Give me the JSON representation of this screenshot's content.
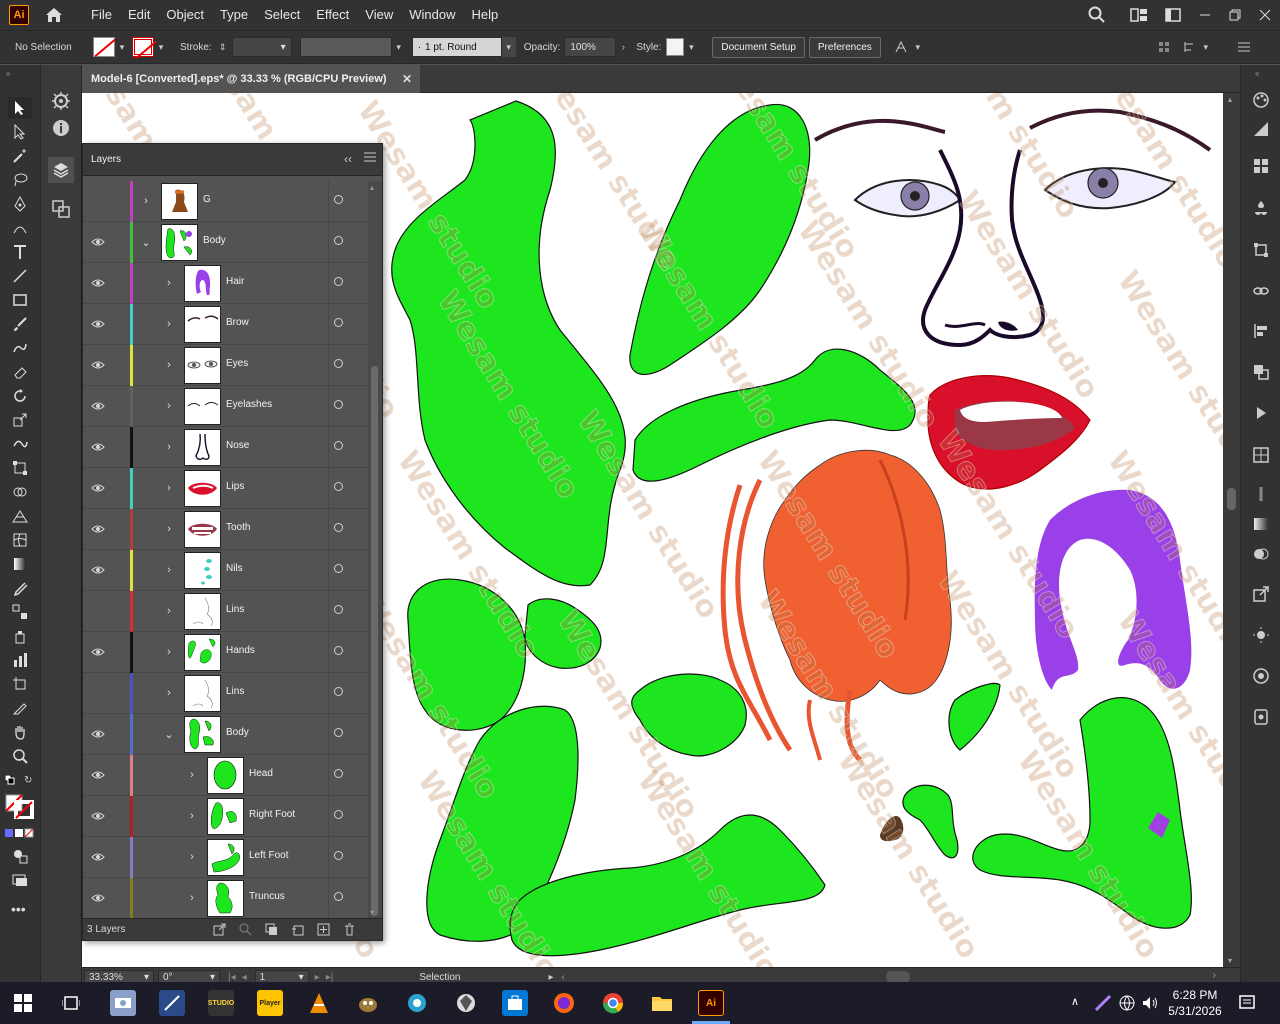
{
  "app": {
    "logo": "Ai",
    "menu": [
      "File",
      "Edit",
      "Object",
      "Type",
      "Select",
      "Effect",
      "View",
      "Window",
      "Help"
    ]
  },
  "control_bar": {
    "selection_state": "No Selection",
    "stroke_label": "Stroke:",
    "brush": "1 pt. Round",
    "opacity_label": "Opacity:",
    "opacity_value": "100%",
    "style_label": "Style:",
    "document_setup": "Document Setup",
    "preferences": "Preferences"
  },
  "document": {
    "tab_title": "Model-6 [Converted].eps* @ 33.33 % (RGB/CPU Preview)"
  },
  "layers_panel": {
    "title": "Layers",
    "footer_count": "3 Layers",
    "rows": [
      {
        "name": "G",
        "visible": false,
        "color": "#c040c0",
        "depth": 0,
        "expanded": false
      },
      {
        "name": "Body",
        "visible": true,
        "color": "#40c040",
        "depth": 0,
        "expanded": true
      },
      {
        "name": "Hair",
        "visible": true,
        "color": "#c040c0",
        "depth": 1,
        "expanded": false
      },
      {
        "name": "Brow",
        "visible": true,
        "color": "#40d0d0",
        "depth": 1,
        "expanded": false
      },
      {
        "name": "Eyes",
        "visible": true,
        "color": "#e0e040",
        "depth": 1,
        "expanded": false
      },
      {
        "name": "Eyelashes",
        "visible": true,
        "color": "#606060",
        "depth": 1,
        "expanded": false
      },
      {
        "name": "Nose",
        "visible": true,
        "color": "#101010",
        "depth": 1,
        "expanded": false
      },
      {
        "name": "Lips",
        "visible": true,
        "color": "#40d0c0",
        "depth": 1,
        "expanded": false
      },
      {
        "name": "Tooth",
        "visible": true,
        "color": "#b04040",
        "depth": 1,
        "expanded": false
      },
      {
        "name": "Nils",
        "visible": true,
        "color": "#e0e040",
        "depth": 1,
        "expanded": false
      },
      {
        "name": "Lins",
        "visible": false,
        "color": "#d03030",
        "depth": 1,
        "expanded": false
      },
      {
        "name": "Hands",
        "visible": true,
        "color": "#101010",
        "depth": 1,
        "expanded": false
      },
      {
        "name": "Lins",
        "visible": false,
        "color": "#5050c0",
        "depth": 1,
        "expanded": false
      },
      {
        "name": "Body",
        "visible": true,
        "color": "#5070d0",
        "depth": 1,
        "expanded": true
      },
      {
        "name": "Head",
        "visible": true,
        "color": "#e08080",
        "depth": 2,
        "expanded": false
      },
      {
        "name": "Right Foot",
        "visible": true,
        "color": "#b02020",
        "depth": 2,
        "expanded": false
      },
      {
        "name": "Left Foot",
        "visible": true,
        "color": "#8080c0",
        "depth": 2,
        "expanded": false
      },
      {
        "name": "Truncus",
        "visible": true,
        "color": "#808020",
        "depth": 2,
        "expanded": false
      }
    ]
  },
  "status_bar": {
    "zoom": "33.33%",
    "rotation": "0°",
    "artboard": "1",
    "tool": "Selection"
  },
  "watermark": "Wesam studio",
  "taskbar": {
    "time": "6:28 PM",
    "date": "5/31/2026",
    "apps": [
      {
        "name": "studio",
        "label": "STUDIO"
      },
      {
        "name": "player",
        "label": "Player"
      },
      {
        "name": "illustrator",
        "label": "Ai"
      }
    ]
  }
}
